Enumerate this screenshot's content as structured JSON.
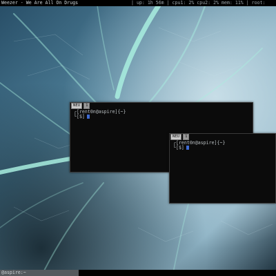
{
  "topbar": {
    "title": "Weezer - We Are All On Drugs",
    "status": "| up: 1h 56m | cpu1: 2% cpu2: 2% mem: 11% | root:"
  },
  "terminals": [
    {
      "tab_label": "NEU",
      "tab_index": "1",
      "prompt_line1": "┌[rent0n@aspire]{~}",
      "prompt_line2": "└[$]"
    },
    {
      "tab_label": "NEU",
      "tab_index": "1",
      "prompt_line1": "┌[rent0n@aspire]{~}",
      "prompt_line2": "└[$]"
    }
  ],
  "bottombar": {
    "location": "@aspire:~"
  },
  "colors": {
    "wallpaper_base": "#0e1a24",
    "leaf_vein": "#9fe6d7",
    "terminal_bg": "#0b0b0b",
    "cursor": "#3f6bd1"
  }
}
